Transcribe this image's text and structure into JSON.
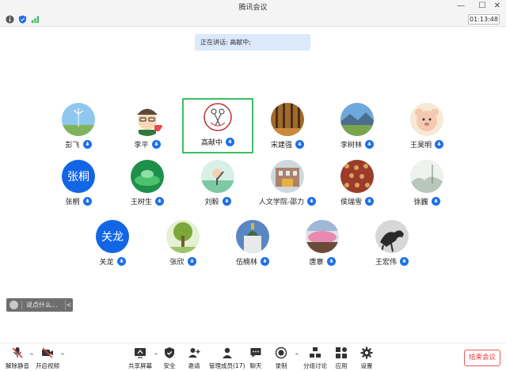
{
  "window": {
    "title": "腾讯会议",
    "controls": {
      "minimize": "—",
      "maximize": "☐",
      "close": "✕"
    }
  },
  "info_bar": {
    "timer": "01:13:48",
    "icons": [
      "info-icon",
      "shield-icon",
      "signal-icon"
    ]
  },
  "speaking_banner": "正在讲话: 高献中;",
  "participants": [
    {
      "name": "彭飞",
      "avatar": "windmill-photo"
    },
    {
      "name": "李平",
      "avatar": "cartoon-boy"
    },
    {
      "name": "高献中",
      "avatar": "scissors-logo",
      "active": true
    },
    {
      "name": "宋建强",
      "avatar": "forest-photo"
    },
    {
      "name": "李树林",
      "avatar": "landscape-photo"
    },
    {
      "name": "王昊明",
      "avatar": "bear-cartoon"
    },
    {
      "name": "张桐",
      "avatar_text": "张桐"
    },
    {
      "name": "王树生",
      "avatar": "lotus-photo"
    },
    {
      "name": "刘毅",
      "avatar": "cartoon-wave"
    },
    {
      "name": "人文学院-邵力",
      "avatar": "building-photo"
    },
    {
      "name": "侯瑞雪",
      "avatar": "pattern-photo"
    },
    {
      "name": "徐巍",
      "avatar": "ink-painting"
    },
    {
      "name": "关龙",
      "avatar_text": "关龙"
    },
    {
      "name": "张欣",
      "avatar": "tree-photo"
    },
    {
      "name": "伍楠林",
      "avatar": "church-photo"
    },
    {
      "name": "唐寨",
      "avatar": "flowers-photo"
    },
    {
      "name": "王宏伟",
      "avatar": "horse-painting"
    }
  ],
  "chat": {
    "placeholder": "说点什么...",
    "collapse": "<"
  },
  "toolbar": {
    "items": [
      {
        "id": "mute",
        "label": "解除静音",
        "icon": "mic-muted-icon"
      },
      {
        "id": "video",
        "label": "开启视频",
        "icon": "camera-off-icon"
      },
      {
        "id": "share",
        "label": "共享屏幕",
        "icon": "share-screen-icon"
      },
      {
        "id": "security",
        "label": "安全",
        "icon": "shield-icon"
      },
      {
        "id": "invite",
        "label": "邀请",
        "icon": "invite-icon"
      },
      {
        "id": "members",
        "label": "管理成员(17)",
        "icon": "members-icon"
      },
      {
        "id": "chat",
        "label": "聊天",
        "icon": "chat-icon"
      },
      {
        "id": "record",
        "label": "录制",
        "icon": "record-icon"
      },
      {
        "id": "breakout",
        "label": "分组讨论",
        "icon": "breakout-icon"
      },
      {
        "id": "apps",
        "label": "应用",
        "icon": "apps-icon"
      },
      {
        "id": "settings",
        "label": "设置",
        "icon": "gear-icon"
      }
    ],
    "end_meeting": "结束会议"
  },
  "colors": {
    "accent": "#1e6fe6",
    "active_border": "#3fbf62",
    "end": "#e03d3d"
  }
}
